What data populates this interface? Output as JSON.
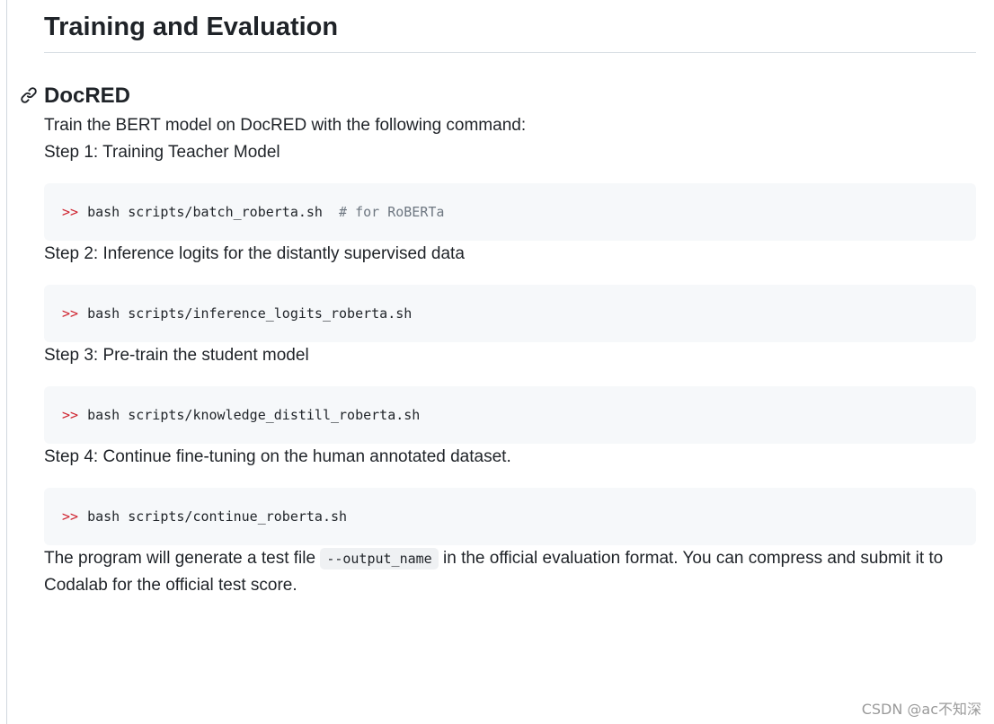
{
  "heading": "Training and Evaluation",
  "subheading": "DocRED",
  "intro": "Train the BERT model on DocRED with the following command:",
  "prompt_symbol": ">>",
  "steps": [
    {
      "label": "Step 1: Training Teacher Model",
      "command": "bash scripts/batch_roberta.sh",
      "comment": "# for RoBERTa"
    },
    {
      "label": "Step 2: Inference logits for the distantly supervised data",
      "command": "bash scripts/inference_logits_roberta.sh",
      "comment": ""
    },
    {
      "label": "Step 3: Pre-train the student model",
      "command": "bash scripts/knowledge_distill_roberta.sh",
      "comment": ""
    },
    {
      "label": "Step 4: Continue fine-tuning on the human annotated dataset.",
      "command": "bash scripts/continue_roberta.sh",
      "comment": ""
    }
  ],
  "final": {
    "before": "The program will generate a test file ",
    "code": "--output_name",
    "after": " in the official evaluation format. You can compress and submit it to Codalab for the official test score."
  },
  "watermark": "CSDN @ac不知深",
  "icons": {
    "anchor": "link-icon"
  },
  "colors": {
    "prompt": "#cf222e",
    "comment": "#6e7781",
    "code_bg": "#f6f8fa"
  }
}
